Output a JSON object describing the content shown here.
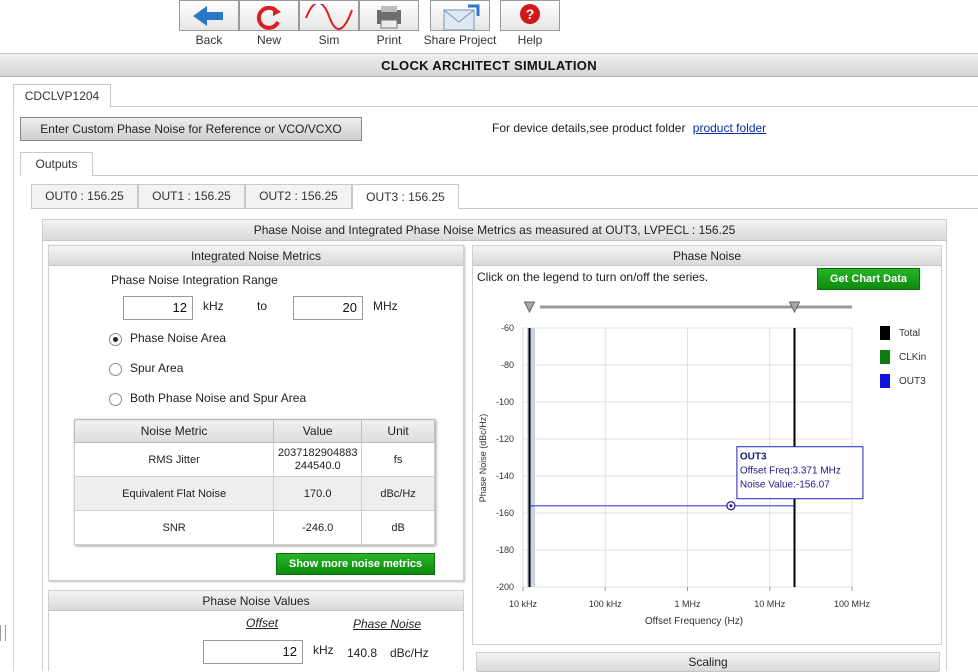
{
  "toolbar": {
    "back": "Back",
    "new": "New",
    "sim": "Sim",
    "print": "Print",
    "share": "Share Project",
    "help": "Help"
  },
  "page_title": "CLOCK ARCHITECT SIMULATION",
  "device_tab": "CDCLVP1204",
  "custom_noise_button": "Enter Custom Phase Noise for Reference or VCO/VCXO",
  "device_details_text": "For device details,see product folder",
  "product_folder_link": "product folder",
  "outputs_tab": "Outputs",
  "out_tabs": [
    {
      "label": "OUT0 : 156.25",
      "active": false
    },
    {
      "label": "OUT1 : 156.25",
      "active": false
    },
    {
      "label": "OUT2 : 156.25",
      "active": false
    },
    {
      "label": "OUT3 : 156.25",
      "active": true
    }
  ],
  "main_panel_title": "Phase Noise and Integrated Phase Noise Metrics as measured at OUT3, LVPECL : 156.25",
  "integrated": {
    "title": "Integrated Noise Metrics",
    "range_label": "Phase Noise Integration Range",
    "from_value": "12",
    "from_unit": "kHz",
    "to_text": "to",
    "to_value": "20",
    "to_unit": "MHz",
    "radios": [
      {
        "label": "Phase Noise Area",
        "checked": true
      },
      {
        "label": "Spur Area",
        "checked": false
      },
      {
        "label": "Both Phase Noise and Spur Area",
        "checked": false
      }
    ],
    "table_headers": [
      "Noise Metric",
      "Value",
      "Unit"
    ],
    "rows": [
      {
        "metric": "RMS Jitter",
        "value_line1": "2037182904883",
        "value_line2": "244540.0",
        "unit": "fs"
      },
      {
        "metric": "Equivalent Flat Noise",
        "value_line1": "170.0",
        "value_line2": "",
        "unit": "dBc/Hz"
      },
      {
        "metric": "SNR",
        "value_line1": "-246.0",
        "value_line2": "",
        "unit": "dB"
      }
    ],
    "more_button": "Show more noise metrics"
  },
  "pn_values": {
    "title": "Phase Noise Values",
    "offset_header": "Offset",
    "pn_header": "Phase Noise",
    "offset_value": "12",
    "offset_unit": "kHz",
    "pn_value": "140.8",
    "pn_unit": "dBc/Hz"
  },
  "phase_noise_panel": {
    "title": "Phase Noise",
    "hint": "Click on the legend to turn on/off the series.",
    "get_data_button": "Get Chart Data"
  },
  "scaling_title": "Scaling",
  "chart_data": {
    "type": "line",
    "x_scale": "log",
    "xlabel": "Offset Frequency (Hz)",
    "ylabel": "Phase Noise (dBc/Hz)",
    "xlim": [
      10000,
      100000000
    ],
    "ylim": [
      -200,
      -60
    ],
    "x_ticks": [
      {
        "value": 10000,
        "label": "10 kHz"
      },
      {
        "value": 100000,
        "label": "100 kHz"
      },
      {
        "value": 1000000,
        "label": "1 MHz"
      },
      {
        "value": 10000000,
        "label": "10 MHz"
      },
      {
        "value": 100000000,
        "label": "100 MHz"
      }
    ],
    "y_ticks": [
      -60,
      -80,
      -100,
      -120,
      -140,
      -160,
      -180,
      -200
    ],
    "grid": true,
    "legend_position": "right",
    "integration_markers_hz": [
      12000,
      20000000
    ],
    "series": [
      {
        "name": "Total",
        "color": "#000000",
        "points": []
      },
      {
        "name": "CLKin",
        "color": "#107c10",
        "points": []
      },
      {
        "name": "OUT3",
        "color": "#1010e0",
        "points": [
          [
            12000,
            -156.07
          ],
          [
            20000000,
            -156.07
          ]
        ]
      }
    ],
    "tooltip": {
      "series": "OUT3",
      "offset_text": "Offset Freq:3.371 MHz",
      "noise_text": "Noise Value:-156.07",
      "x": 3371000,
      "y": -156.07
    }
  },
  "colors": {
    "green_button": "#129912",
    "link": "#0a2ea8"
  }
}
